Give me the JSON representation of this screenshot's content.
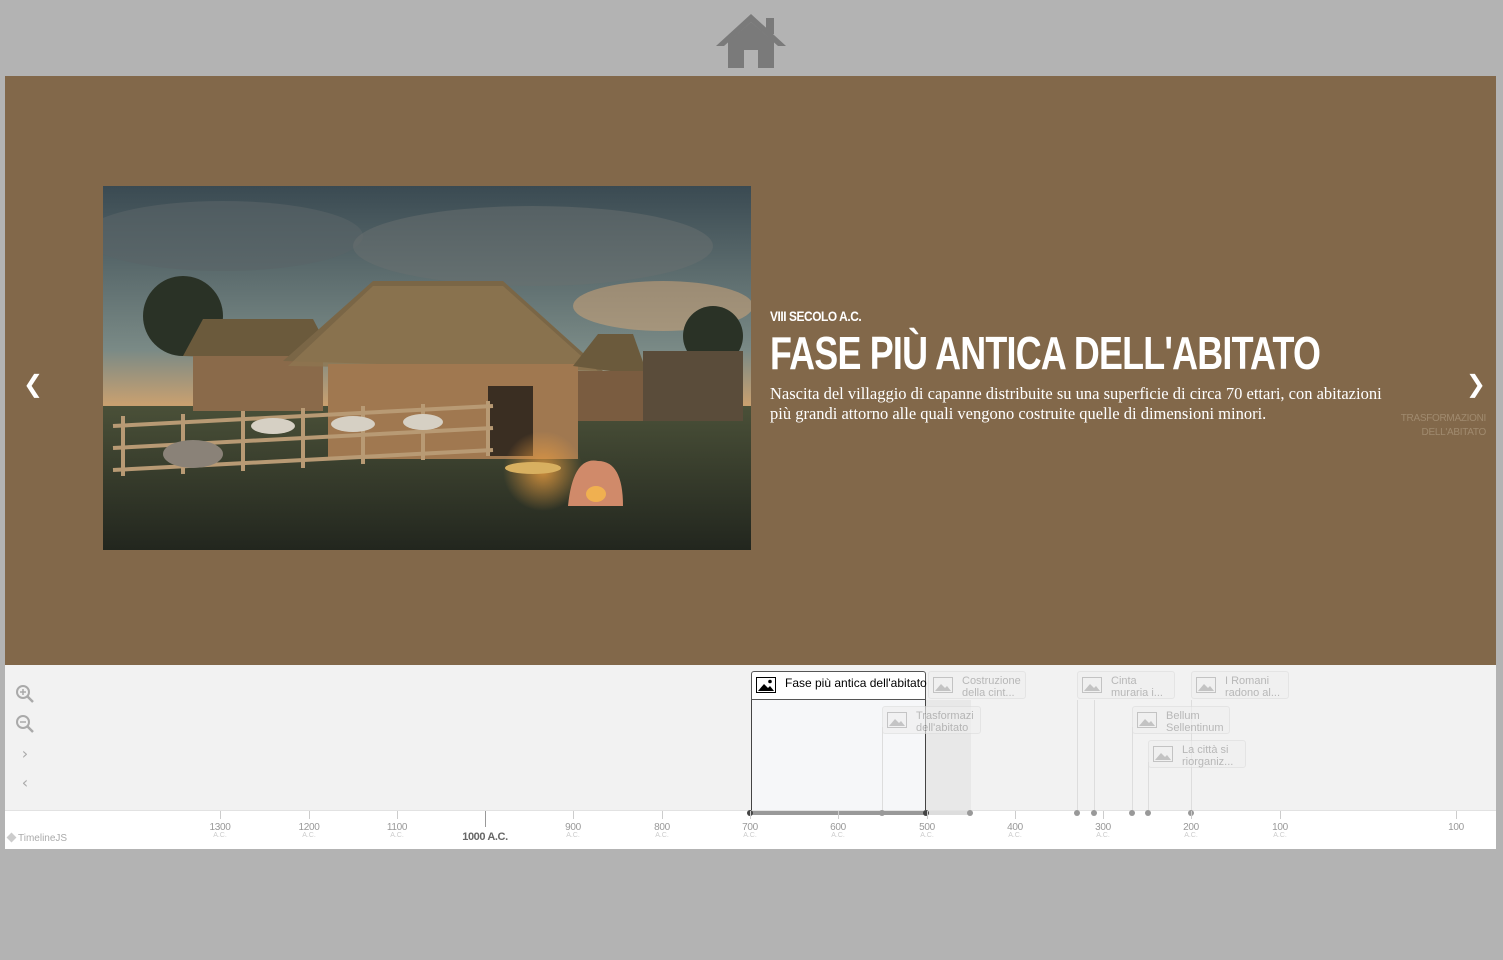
{
  "slide": {
    "date": "VIII SECOLO A.C.",
    "headline": "FASE PIÙ ANTICA DELL'ABITATO",
    "text": "Nascita del villaggio di capanne distribuite su una superficie di circa 70 ettari, con abitazioni più grandi attorno alle quali vengono costruite quelle di dimensioni minori.",
    "next_label_line1": "TRASFORMAZIONI",
    "next_label_line2": "DELL'ABITATO"
  },
  "colors": {
    "slide_bg": "#82684a",
    "page_bg": "#b3b3b3",
    "nav_bg": "#f2f2f2"
  },
  "icons": {
    "home": "home-icon",
    "prev": "chevron-left-icon",
    "next": "chevron-right-icon",
    "zoom_in": "zoom-in-icon",
    "zoom_out": "zoom-out-icon",
    "marker": "image-icon"
  },
  "markers": [
    {
      "title": "Fase più antica dell'abitato",
      "active": true
    },
    {
      "title": "Costruzione della cint..."
    },
    {
      "title": "Trasformazi dell'abitato"
    },
    {
      "title": "Cinta muraria i..."
    },
    {
      "title": "I Romani radono al..."
    },
    {
      "title": "Bellum Sellentinum"
    },
    {
      "title": "La città si riorganiz..."
    }
  ],
  "axis": {
    "era": "A.C.",
    "ticks": [
      "1300",
      "1200",
      "1100",
      "900",
      "800",
      "700",
      "600",
      "500",
      "400",
      "300",
      "200",
      "100",
      "100"
    ],
    "major": "1000 A.C."
  },
  "branding": "TimelineJS"
}
